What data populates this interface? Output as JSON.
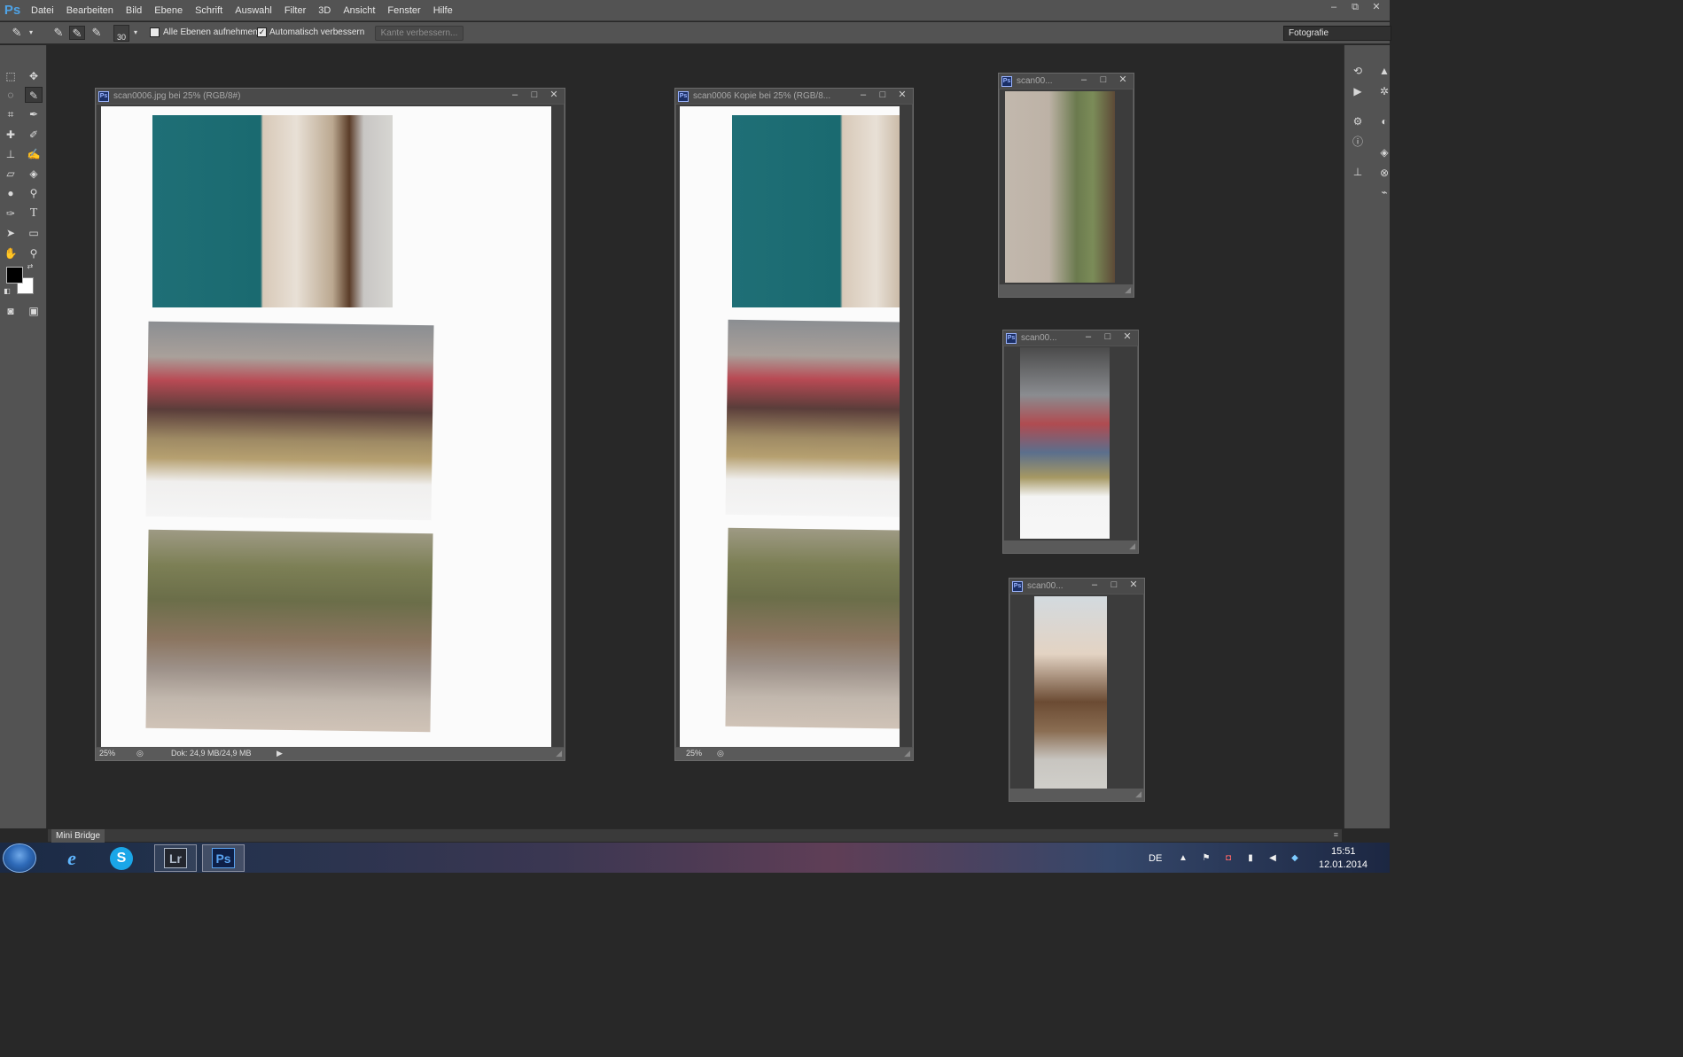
{
  "app": {
    "logo": "Ps"
  },
  "menu": [
    "Datei",
    "Bearbeiten",
    "Bild",
    "Ebene",
    "Schrift",
    "Auswahl",
    "Filter",
    "3D",
    "Ansicht",
    "Fenster",
    "Hilfe"
  ],
  "window_controls": {
    "minimize": "–",
    "restore": "⧉",
    "close": "✕"
  },
  "options": {
    "brush_size": "30",
    "all_layers_label": "Alle Ebenen aufnehmen",
    "all_layers_checked": false,
    "auto_enhance_label": "Automatisch verbessern",
    "auto_enhance_checked": true,
    "refine_edge_label": "Kante verbessern...",
    "workspace": "Fotografie"
  },
  "documents": [
    {
      "title": "scan0006.jpg bei 25% (RGB/8#)",
      "zoom": "25%",
      "doc_info": "Dok: 24,9 MB/24,9 MB"
    },
    {
      "title": "scan0006 Kopie bei 25% (RGB/8...",
      "zoom": "25%"
    },
    {
      "title": "scan00..."
    },
    {
      "title": "scan00..."
    },
    {
      "title": "scan00..."
    }
  ],
  "doc_icon": "Ps",
  "mini_bridge": {
    "label": "Mini Bridge"
  },
  "taskbar": {
    "apps": [
      {
        "icon": "start-orb-icon"
      },
      {
        "icon": "internet-explorer-icon"
      },
      {
        "icon": "skype-icon"
      },
      {
        "icon": "lightroom-icon",
        "label": "Lr"
      },
      {
        "icon": "photoshop-icon",
        "label": "Ps"
      }
    ],
    "language": "DE",
    "time": "15:51",
    "date": "12.01.2014"
  },
  "colors": {
    "foreground": "#000000",
    "background": "#ffffff",
    "ps_blue": "#4fa3e6"
  }
}
